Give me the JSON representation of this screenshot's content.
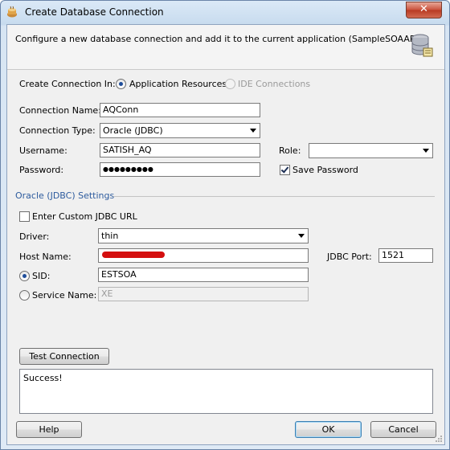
{
  "window": {
    "title": "Create Database Connection",
    "close_glyph": "✕"
  },
  "banner": {
    "text": "Configure a new database connection and add it to the current application (SampleSOAAPP)."
  },
  "create_in": {
    "label": "Create Connection In:",
    "option_app": "Application Resources",
    "option_ide": "IDE Connections"
  },
  "form": {
    "connection_name_label": "Connection Name:",
    "connection_name_value": "AQConn",
    "connection_type_label": "Connection Type:",
    "connection_type_value": "Oracle (JDBC)",
    "username_label": "Username:",
    "username_value": "SATISH_AQ",
    "password_label": "Password:",
    "password_value": "●●●●●●●●●",
    "role_label": "Role:",
    "role_value": "",
    "save_password_label": "Save Password"
  },
  "jdbc": {
    "section_title": "Oracle (JDBC) Settings",
    "custom_url_label": "Enter Custom JDBC URL",
    "driver_label": "Driver:",
    "driver_value": "thin",
    "host_label": "Host Name:",
    "host_value": "",
    "port_label": "JDBC Port:",
    "port_value": "1521",
    "sid_label": "SID:",
    "sid_value": "ESTSOA",
    "service_label": "Service Name:",
    "service_value": "XE"
  },
  "test": {
    "button_label": "Test Connection",
    "result": "Success!"
  },
  "footer": {
    "help_label": "Help",
    "ok_label": "OK",
    "cancel_label": "Cancel"
  }
}
